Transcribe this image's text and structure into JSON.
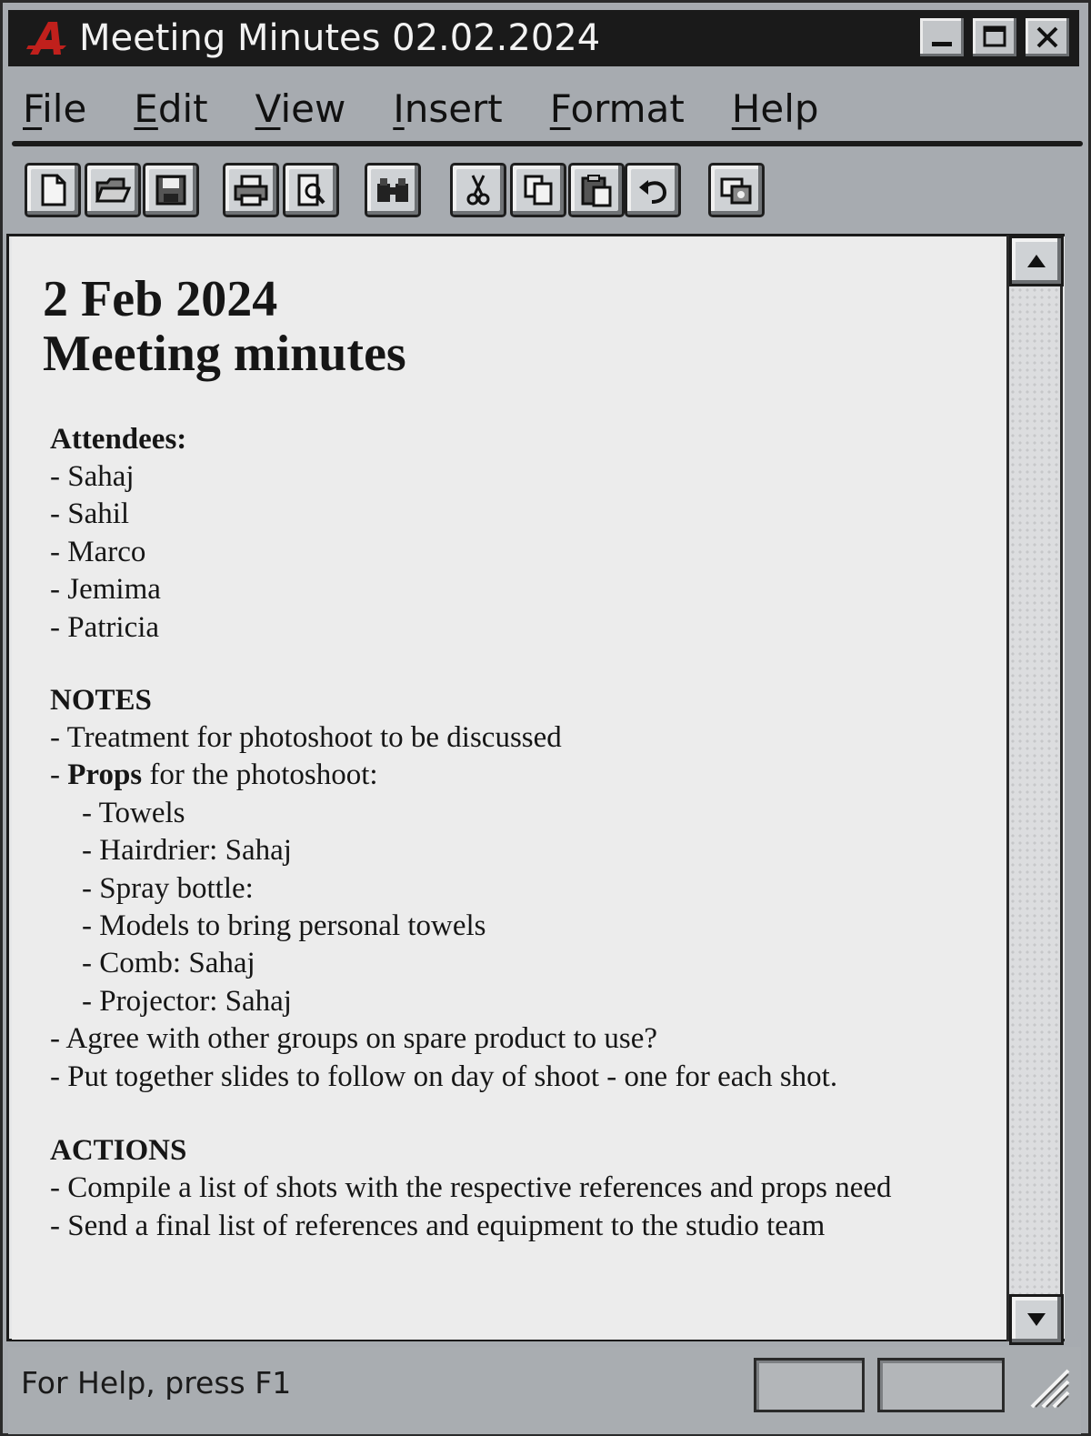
{
  "window": {
    "title": "Meeting Minutes 02.02.2024",
    "app_icon": "app-logo-icon",
    "controls": [
      "minimize-icon",
      "maximize-icon",
      "close-icon"
    ]
  },
  "menubar": {
    "items": [
      {
        "accel": "F",
        "rest": "ile"
      },
      {
        "accel": "E",
        "rest": "dit"
      },
      {
        "accel": "V",
        "rest": "iew"
      },
      {
        "accel": "I",
        "rest": "nsert"
      },
      {
        "accel": "F",
        "rest": "ormat"
      },
      {
        "accel": "H",
        "rest": "elp"
      }
    ]
  },
  "toolbar": {
    "buttons": [
      "new-document-icon",
      "open-folder-icon",
      "save-icon",
      "print-icon",
      "print-preview-icon",
      "find-icon",
      "cut-icon",
      "copy-icon",
      "paste-icon",
      "undo-icon",
      "insert-object-icon"
    ]
  },
  "document": {
    "title_line1": "2 Feb 2024",
    "title_line2": "Meeting minutes",
    "attendees_heading": "Attendees:",
    "attendees": [
      "- Sahaj",
      "- Sahil",
      "- Marco",
      "- Jemima",
      "- Patricia"
    ],
    "notes_heading": "NOTES",
    "notes_line1": "- Treatment for photoshoot to be discussed",
    "props_prefix": "- ",
    "props_bold": "Props",
    "props_rest": " for the photoshoot:",
    "props_items": [
      "- Towels",
      "- Hairdrier: Sahaj",
      "- Spray bottle:",
      "- Models to bring personal towels",
      "- Comb: Sahaj",
      "- Projector: Sahaj"
    ],
    "notes_line_after1": "- Agree with other groups on spare product to use?",
    "notes_line_after2": "- Put together slides to follow on day of shoot - one for each shot.",
    "actions_heading": "ACTIONS",
    "actions": [
      "- Compile a list of shots with the respective references and props need",
      "- Send a final list of references and equipment to the studio team"
    ]
  },
  "scrollbar": {
    "up_icon": "scroll-up-arrow-icon",
    "down_icon": "scroll-down-arrow-icon"
  },
  "statusbar": {
    "help_text": "For Help, press F1",
    "grip_icon": "resize-grip-icon"
  }
}
